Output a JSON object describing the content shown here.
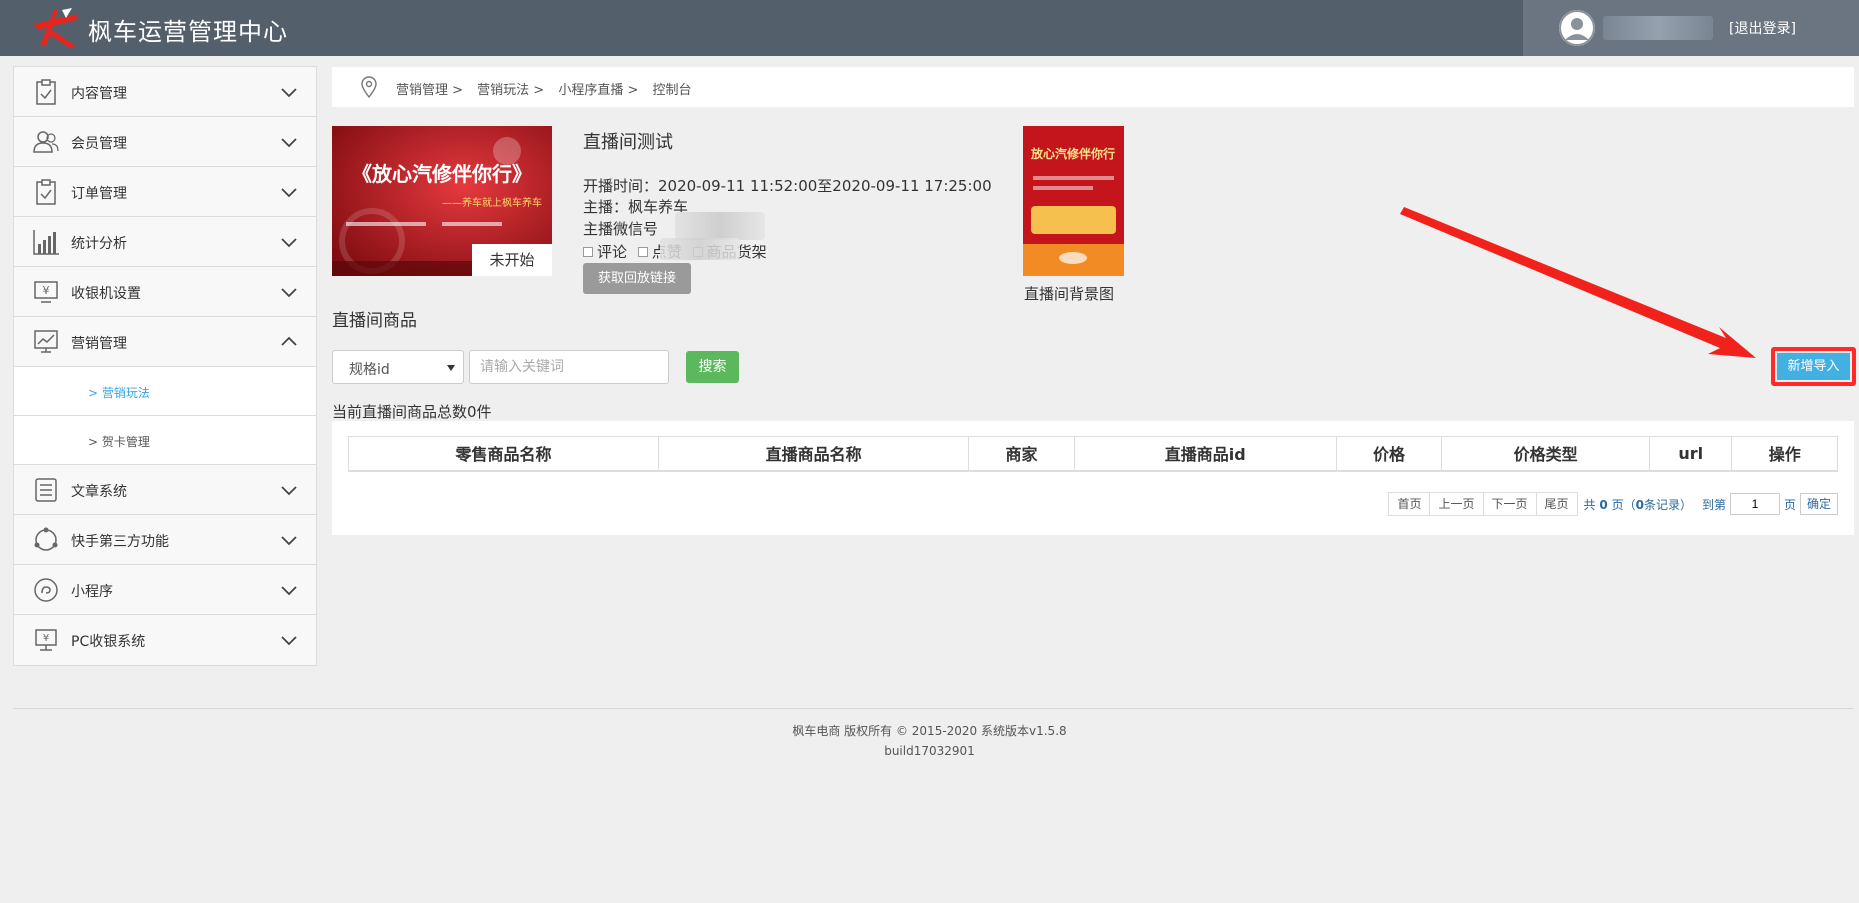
{
  "header": {
    "app_title": "枫车运营管理中心",
    "logout": "[退出登录]"
  },
  "sidebar": {
    "items": [
      {
        "label": "内容管理",
        "icon": "clipboard-icon"
      },
      {
        "label": "会员管理",
        "icon": "users-icon"
      },
      {
        "label": "订单管理",
        "icon": "order-icon"
      },
      {
        "label": "统计分析",
        "icon": "bar-chart-icon"
      },
      {
        "label": "收银机设置",
        "icon": "cashier-icon"
      },
      {
        "label": "营销管理",
        "icon": "trend-chart-icon",
        "expanded": true
      },
      {
        "label": "文章系统",
        "icon": "list-icon"
      },
      {
        "label": "快手第三方功能",
        "icon": "cycle-icon"
      },
      {
        "label": "小程序",
        "icon": "miniprogram-icon"
      },
      {
        "label": "PC收银系统",
        "icon": "pc-cashier-icon"
      }
    ],
    "sub_items": [
      {
        "label": "> 营销玩法",
        "active": true
      },
      {
        "label": "> 贺卡管理",
        "active": false
      }
    ]
  },
  "breadcrumb": [
    "营销管理 >",
    "营销玩法 >",
    "小程序直播 >",
    "控制台"
  ],
  "room": {
    "title": "直播间测试",
    "time": "开播时间：2020-09-11 11:52:00至2020-09-11 17:25:00",
    "anchor": "主播：枫车养车",
    "wechat_label": "主播微信号",
    "options": [
      "评论",
      "点赞",
      "商品货架"
    ],
    "playback_button": "获取回放链接",
    "status": "未开始",
    "cover_text": "《放心汽修伴你行》",
    "cover_subtext": "——养车就上枫车养车",
    "bg_caption": "直播间背景图",
    "bg_text": "放心汽修伴你行"
  },
  "goods": {
    "section_title": "直播间商品",
    "select_value": "规格id",
    "search_placeholder": "请输入关键词",
    "search_button": "搜索",
    "new_import_button": "新增导入",
    "total_text": "当前直播间商品总数0件",
    "columns": [
      "零售商品名称",
      "直播商品名称",
      "商家",
      "直播商品id",
      "价格",
      "价格类型",
      "url",
      "操作"
    ]
  },
  "pager": {
    "first": "首页",
    "prev": "上一页",
    "next": "下一页",
    "last": "尾页",
    "info_prefix": "共",
    "pages": "0",
    "info_mid": "页（",
    "records": "0",
    "info_suffix": "条记录）",
    "goto": "到第",
    "page_value": "1",
    "page_unit": "页",
    "ok": "确定"
  },
  "footer": {
    "line1": "枫车电商 版权所有 © 2015-2020 系统版本v1.5.8",
    "line2": "build17032901"
  },
  "colors": {
    "header": "#535f6b",
    "accent_blue": "#43b0e4",
    "search_green": "#5cb85c",
    "annotation_red": "#ff2a2a"
  }
}
